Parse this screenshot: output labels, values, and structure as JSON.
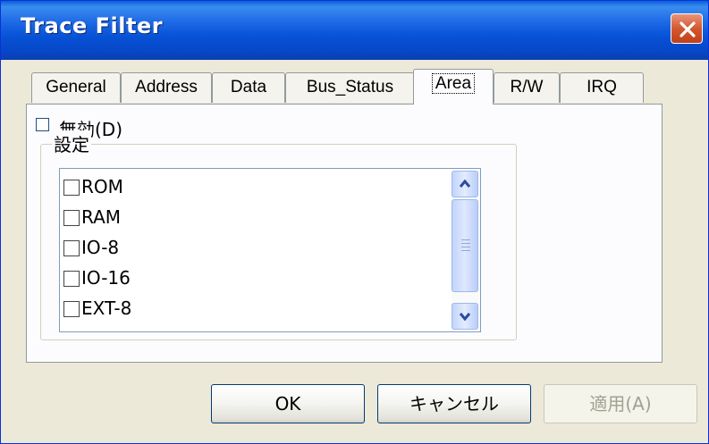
{
  "window": {
    "title": "Trace Filter"
  },
  "tabs": [
    {
      "label": "General"
    },
    {
      "label": "Address"
    },
    {
      "label": "Data"
    },
    {
      "label": "Bus_Status"
    },
    {
      "label": "Area"
    },
    {
      "label": "R/W"
    },
    {
      "label": "IRQ"
    }
  ],
  "active_tab": "Area",
  "panel": {
    "disable_label": "無効(D)",
    "group_label": "設定",
    "items": [
      {
        "label": "ROM",
        "checked": false
      },
      {
        "label": "RAM",
        "checked": false
      },
      {
        "label": "IO-8",
        "checked": false
      },
      {
        "label": "IO-16",
        "checked": false
      },
      {
        "label": "EXT-8",
        "checked": false
      }
    ]
  },
  "buttons": {
    "ok": "OK",
    "cancel": "キャンセル",
    "apply": "適用(A)"
  },
  "colors": {
    "titlebar": "#0752d6",
    "close": "#d4582f",
    "face": "#ece9d8",
    "panel": "#fcfcfe"
  }
}
